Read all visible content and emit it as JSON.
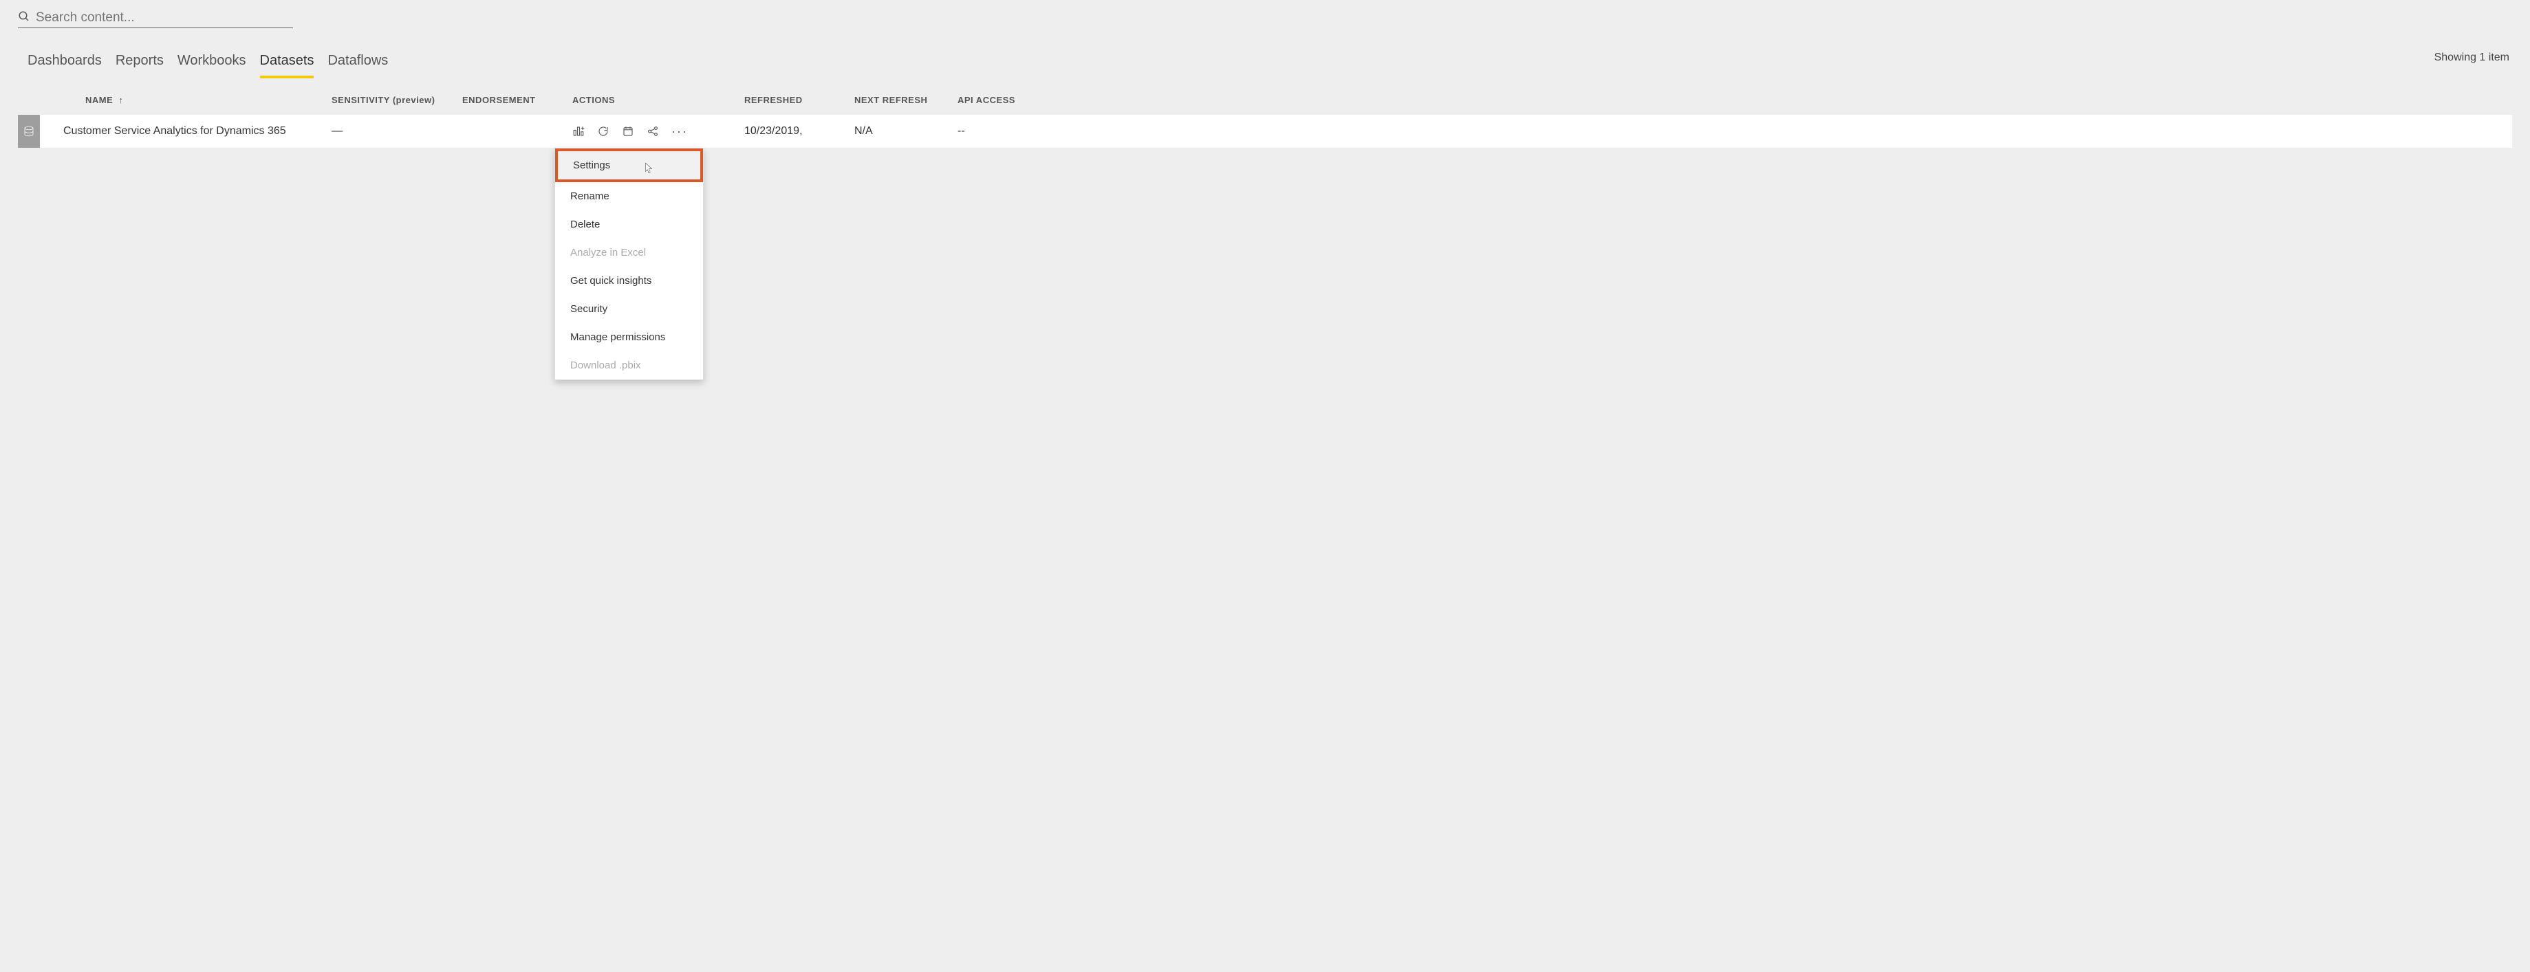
{
  "search": {
    "placeholder": "Search content..."
  },
  "item_count_label": "Showing 1 item",
  "tabs": {
    "dashboards": "Dashboards",
    "reports": "Reports",
    "workbooks": "Workbooks",
    "datasets": "Datasets",
    "dataflows": "Dataflows"
  },
  "columns": {
    "name": "NAME",
    "sensitivity": "SENSITIVITY (preview)",
    "endorsement": "ENDORSEMENT",
    "actions": "ACTIONS",
    "refreshed": "REFRESHED",
    "next_refresh": "NEXT REFRESH",
    "api_access": "API ACCESS"
  },
  "row": {
    "name": "Customer Service Analytics for Dynamics 365",
    "sensitivity": "—",
    "endorsement": "",
    "refreshed": "10/23/2019,",
    "next_refresh": "N/A",
    "api_access": "--"
  },
  "menu": {
    "settings": "Settings",
    "rename": "Rename",
    "delete": "Delete",
    "analyze": "Analyze in Excel",
    "insights": "Get quick insights",
    "security": "Security",
    "permissions": "Manage permissions",
    "download": "Download .pbix"
  }
}
